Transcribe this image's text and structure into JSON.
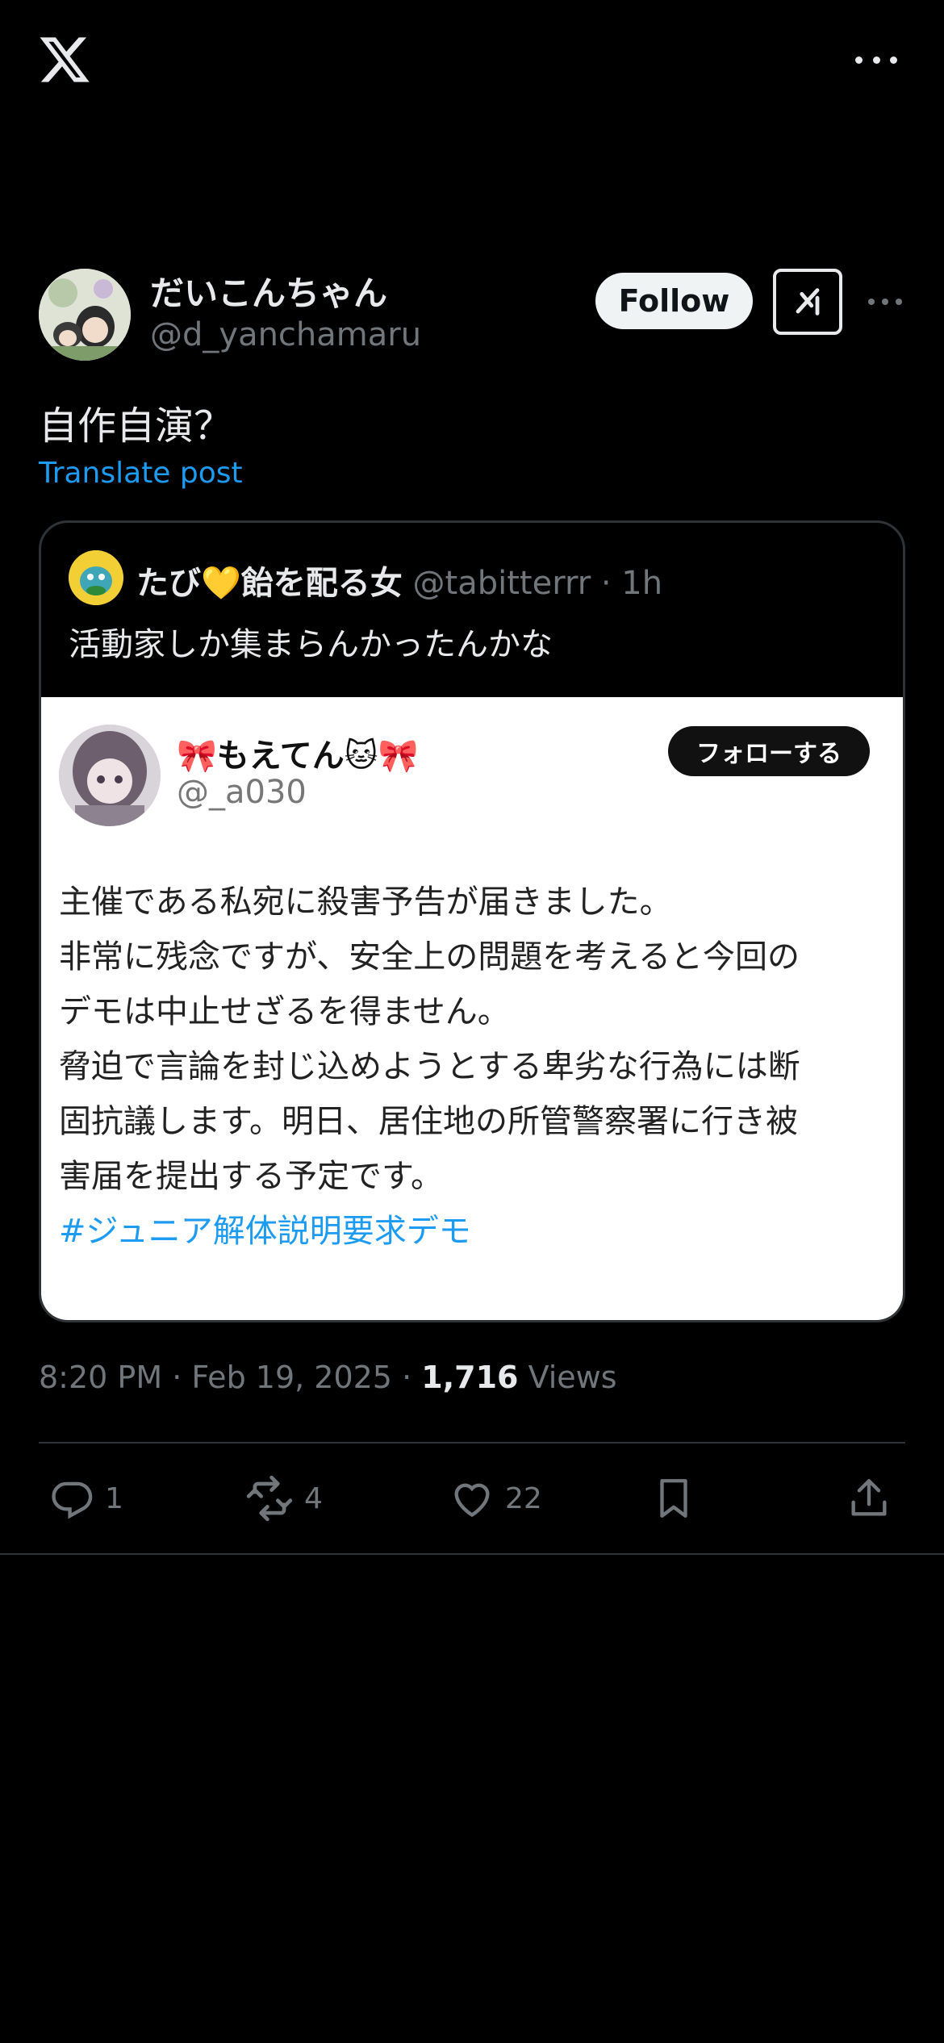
{
  "app": {
    "logo_icon": "x-logo-icon",
    "more_icon": "more-horizontal-icon"
  },
  "post": {
    "author": {
      "display_name": "だいこんちゃん",
      "handle": "@d_yanchamaru"
    },
    "follow_label": "Follow",
    "grok_icon": "grok-icon",
    "text": "自作自演？",
    "translate_label": "Translate post",
    "quote": {
      "display_name": "たび💛飴を配る女",
      "handle": "@tabitterrr",
      "separator": "·",
      "time": "1h",
      "text": "活動家しか集まらんかったんかな",
      "screenshot": {
        "display_name": "🎀もえてん🐱🎀",
        "handle": "@_a030",
        "follow_label": "フォローする",
        "lines": [
          "主催である私宛に殺害予告が届きました。",
          "非常に残念ですが、安全上の問題を考えると今回の",
          "デモは中止せざるを得ません。",
          "脅迫で言論を封じ込めようとする卑劣な行為には断",
          "固抗議します。明日、居住地の所管警察署に行き被",
          "害届を提出する予定です。"
        ],
        "hashtag": "#ジュニア解体説明要求デモ"
      }
    },
    "timestamp": {
      "time": "8:20 PM",
      "sep1": "·",
      "date": "Feb 19, 2025",
      "sep2": "·",
      "views_count": "1,716",
      "views_label": "Views"
    },
    "actions": {
      "replies": "1",
      "reposts": "4",
      "likes": "22"
    }
  },
  "colors": {
    "background": "#000000",
    "text_primary": "#e7e9ea",
    "text_secondary": "#71767b",
    "link": "#1d9bf0",
    "divider": "#2f3336"
  }
}
